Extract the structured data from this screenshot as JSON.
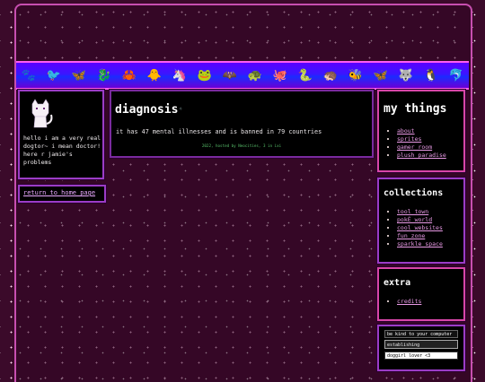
{
  "profile": {
    "text": "hello i am a very real dogtor~ i mean doctor! here r jamie's problems",
    "home_link": "return to home page"
  },
  "main": {
    "title": "diagnosis",
    "message": "it has 47 mental illnesses and is banned in 79 countries",
    "footer": "2022, hosted by Neocities, 3 in ixi"
  },
  "nav": {
    "things_title": "my things",
    "things": [
      "about",
      "sprites",
      "gamer room",
      "plush paradise"
    ],
    "collections_title": "collections",
    "collections": [
      "tool town",
      "pokÉ world",
      "cool websites",
      "fun zone",
      "sparkle space"
    ],
    "extra_title": "extra",
    "extra": [
      "credits"
    ]
  },
  "badges": {
    "b1": "be kind to your computer",
    "b2": "establishing connection...",
    "b3": "doggirl lover <3"
  },
  "colors": {
    "accent": "#c84fb0",
    "link": "#e99ae6",
    "banner": "#3a16ff"
  },
  "banner_icons": [
    "🐾",
    "🐦",
    "🦋",
    "🐉",
    "🦀",
    "🐥",
    "🦄",
    "🐸",
    "🦇",
    "🐢",
    "🐙",
    "🐍",
    "🦔",
    "🐝",
    "🦋",
    "🐺",
    "🐧",
    "🐬"
  ]
}
